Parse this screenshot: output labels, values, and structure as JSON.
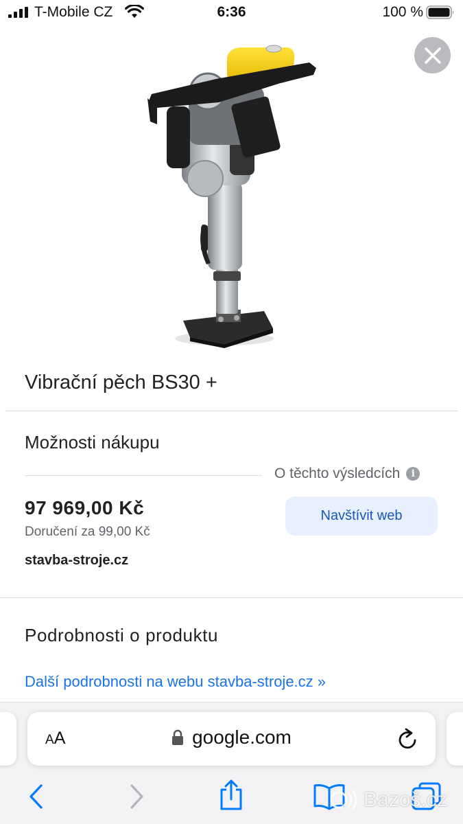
{
  "status_bar": {
    "carrier": "T-Mobile CZ",
    "time": "6:36",
    "battery": "100 %"
  },
  "product": {
    "title": "Vibrační pěch BS30 +",
    "image_icon": "vibratory-rammer-image"
  },
  "shopping": {
    "heading": "Možnosti nákupu",
    "about_results": "O těchto výsledcích",
    "price": "97 969,00 Kč",
    "delivery": "Doručení za 99,00 Kč",
    "store": "stavba-stroje.cz",
    "visit_button": "Navštívit web"
  },
  "details": {
    "heading": "Podrobnosti o produktu",
    "more_link": "Další podrobnosti na webu stavba-stroje.cz »"
  },
  "browser": {
    "text_size_large": "A",
    "text_size_small": "A",
    "url": "google.com"
  },
  "watermark": "Bazoš.cz",
  "colors": {
    "link": "#1a73e8",
    "button_bg": "#e8f0fe",
    "ios_blue": "#007aff"
  }
}
